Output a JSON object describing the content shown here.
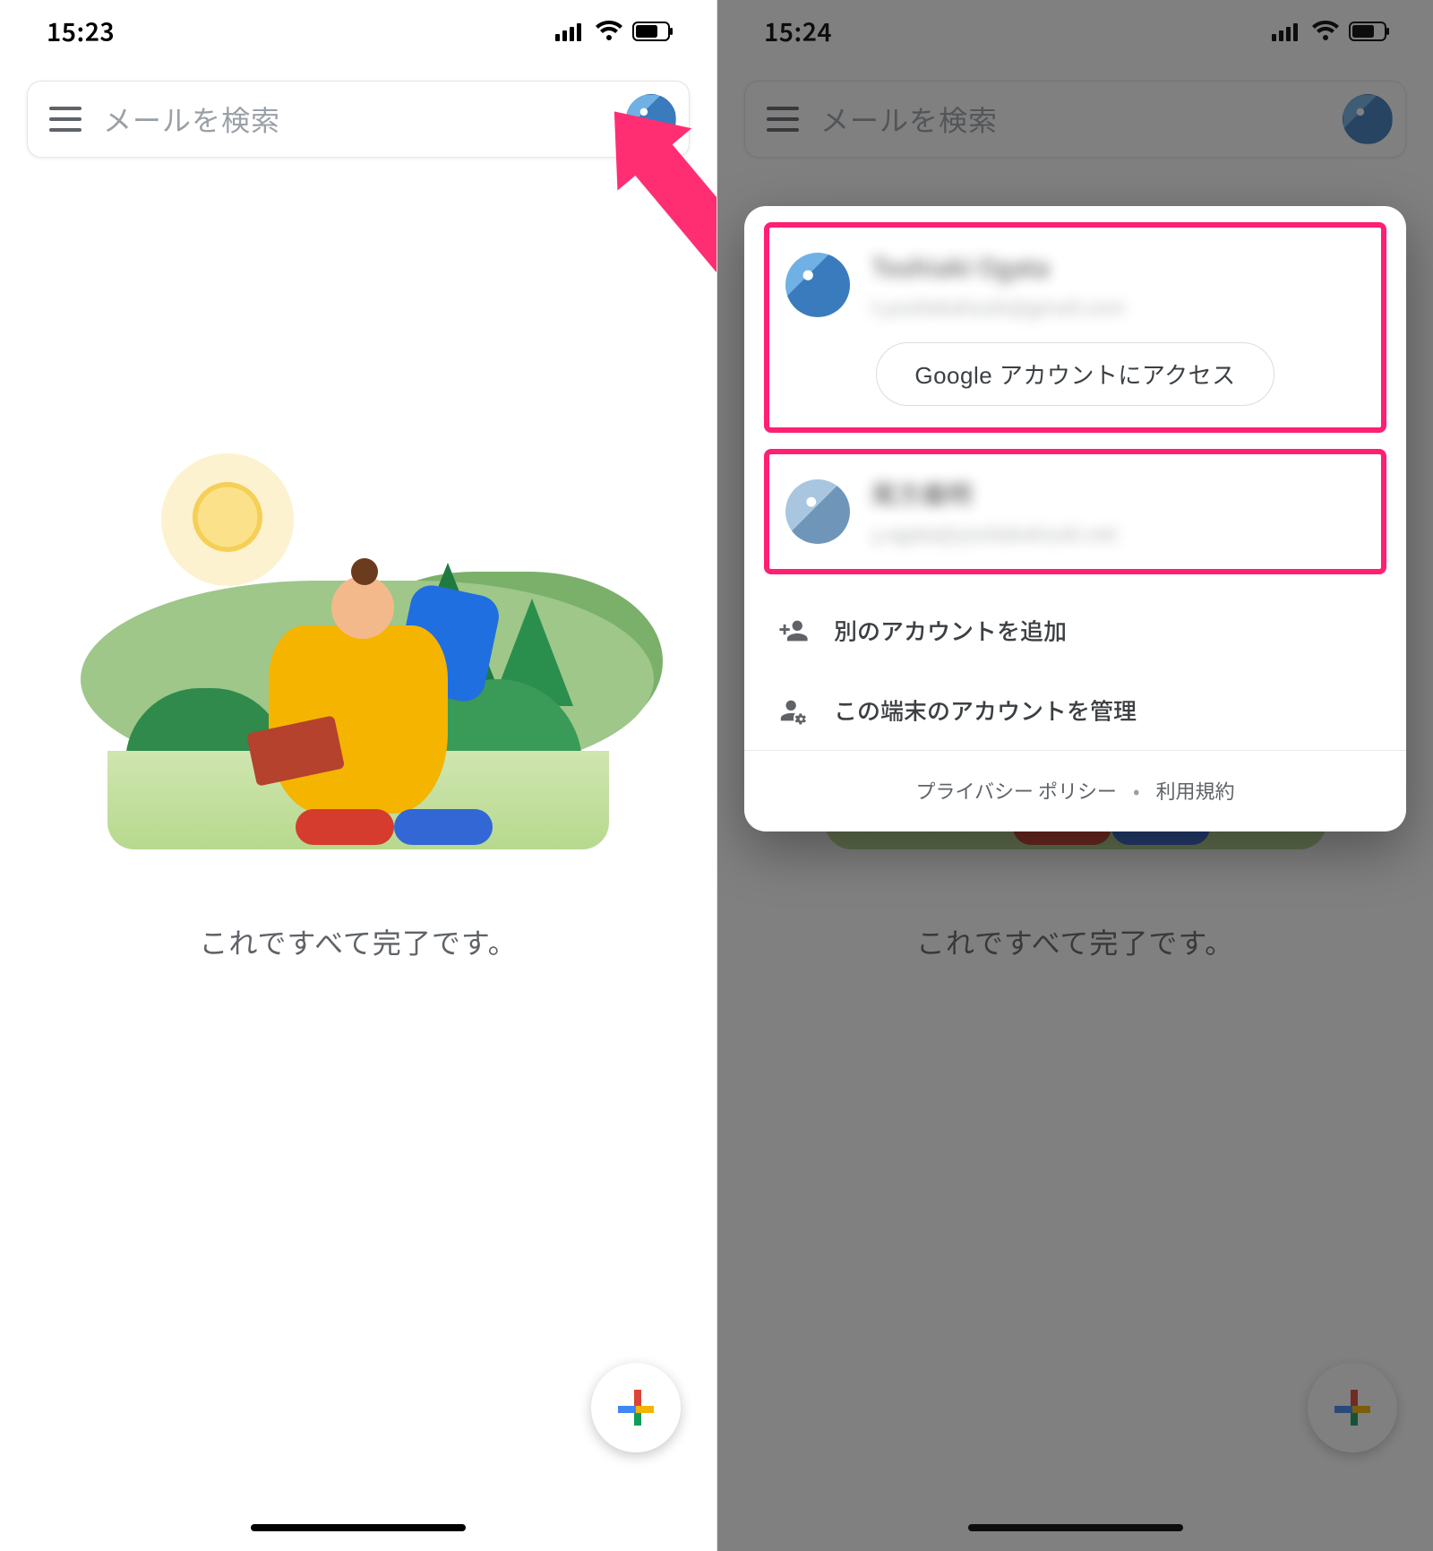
{
  "left": {
    "status_time": "15:23",
    "search_placeholder": "メールを検索",
    "empty_caption": "これですべて完了です。"
  },
  "right": {
    "status_time": "15:24",
    "search_placeholder": "メールを検索",
    "empty_caption": "これですべて完了です。",
    "sheet": {
      "primary_account": {
        "name": "Toshiaki Ogata",
        "email": "t.yositakahzuki@gmail.com"
      },
      "access_button_google": "Google",
      "access_button_rest": " アカウントにアクセス",
      "secondary_account": {
        "name": "尾方義明",
        "email": "y.ogata@yositakahzuki.net"
      },
      "add_account": "別のアカウントを追加",
      "manage_accounts": "この端末のアカウントを管理",
      "privacy": "プライバシー ポリシー",
      "terms": "利用規約"
    }
  }
}
